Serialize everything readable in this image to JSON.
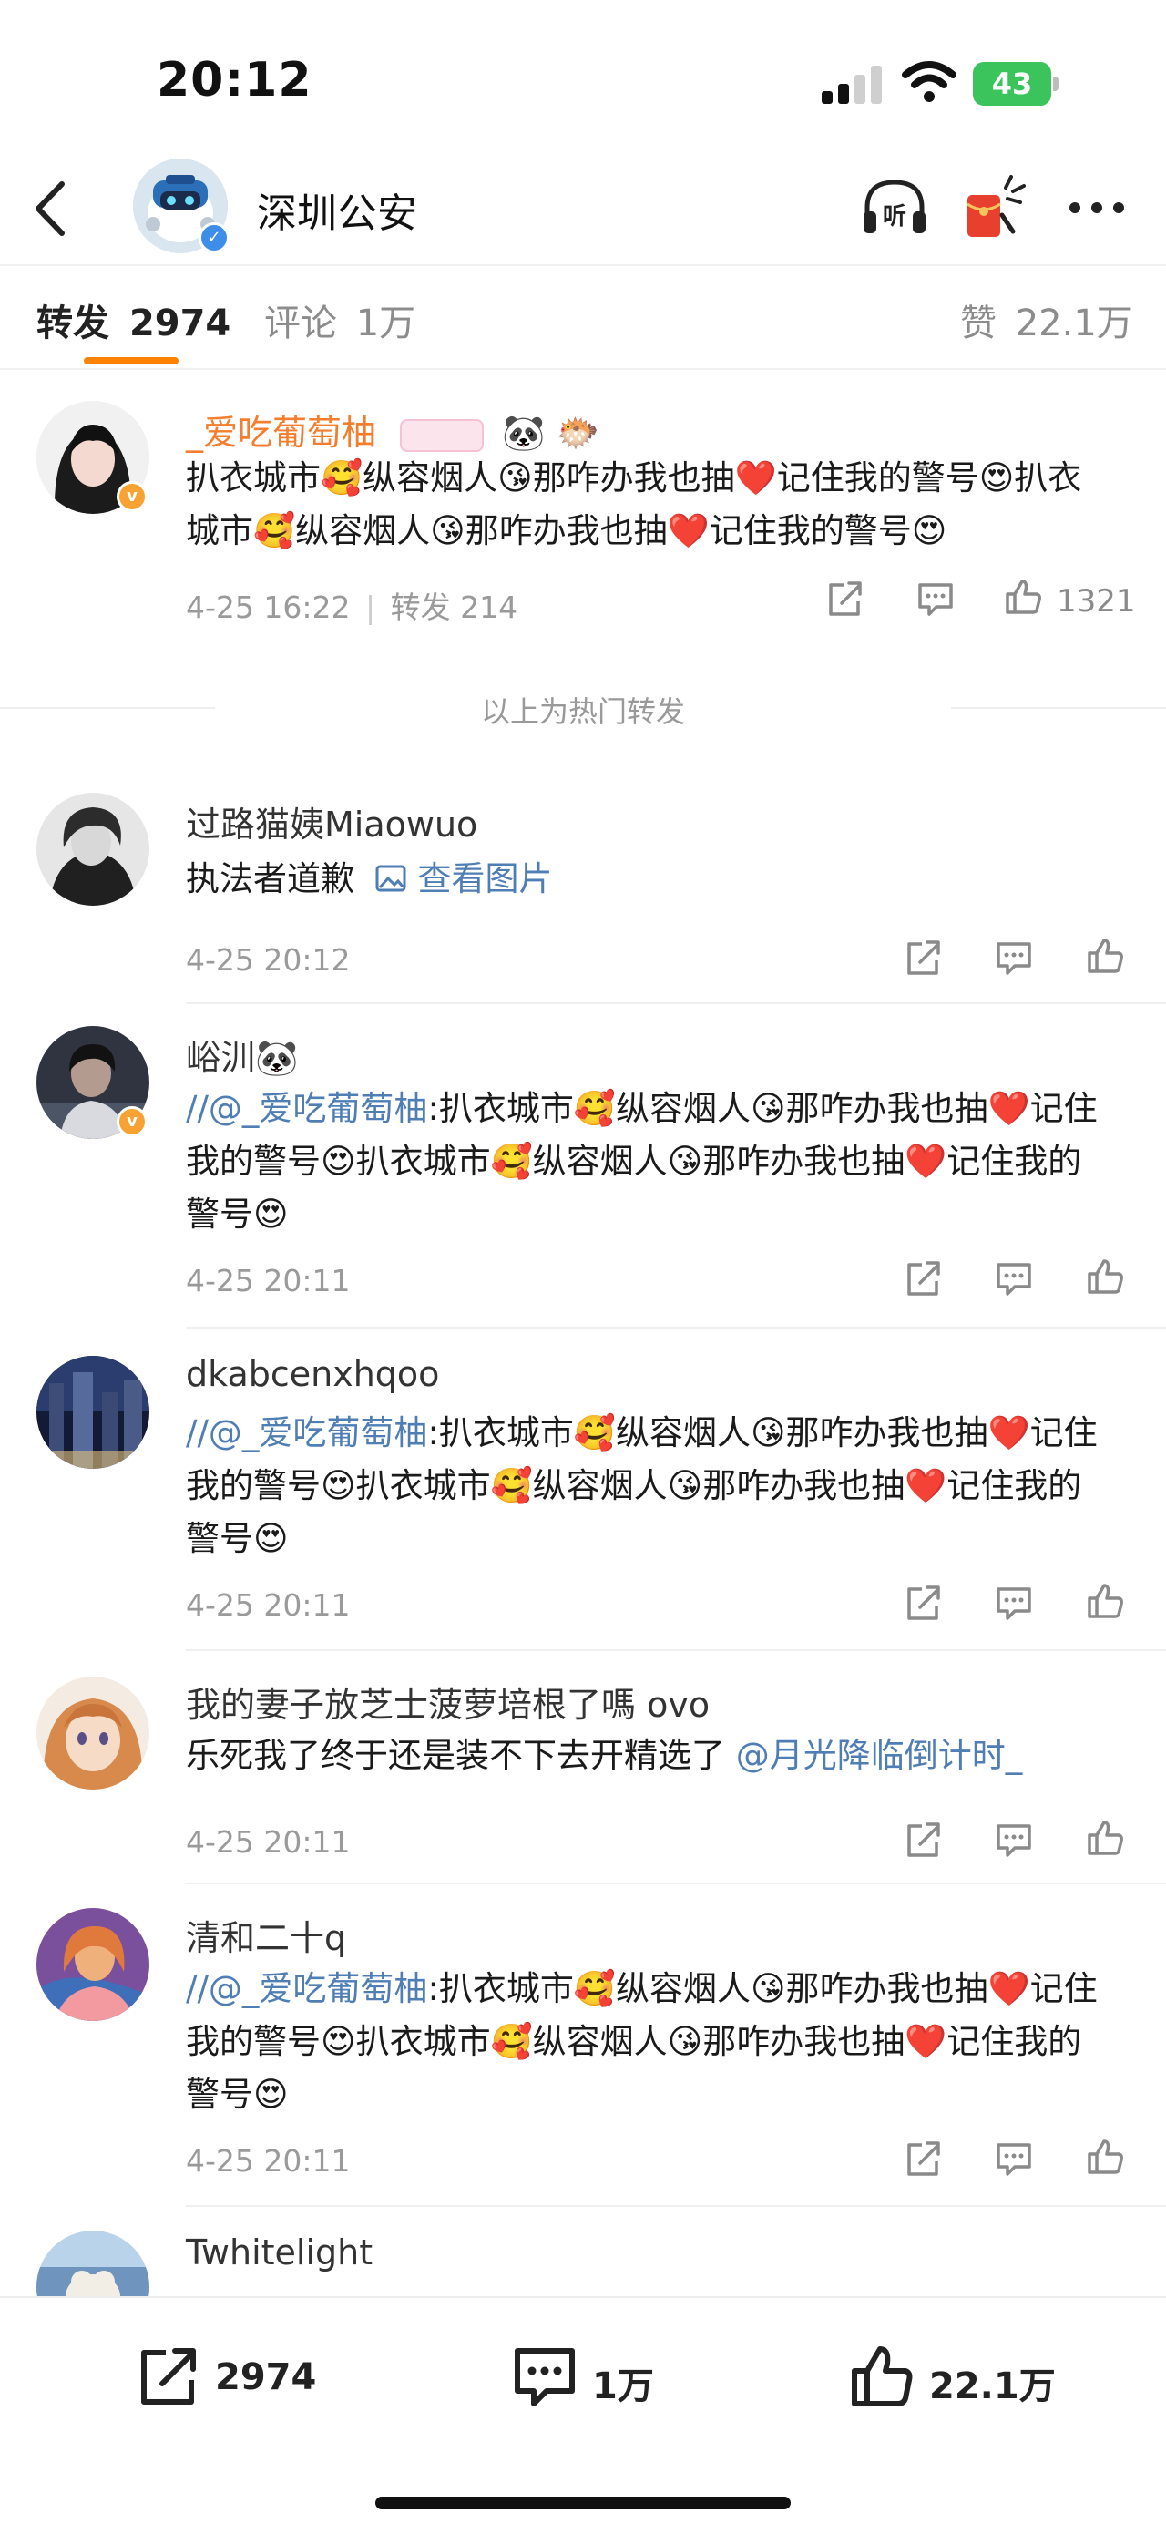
{
  "status": {
    "time": "20:12",
    "battery": "43"
  },
  "header": {
    "title": "深圳公安",
    "back_icon": "chevron-left-icon",
    "listen_icon": "headphones-listen-icon",
    "listen_label": "听",
    "redpacket_icon": "red-packet-icon",
    "more_icon": "more-dots-icon"
  },
  "tabs": {
    "repost_label": "转发",
    "repost_count": "2974",
    "comment_label": "评论",
    "comment_count": "1万",
    "like_label": "赞",
    "like_count": "22.1万"
  },
  "hot_item": {
    "name": "_爱吃葡萄柚",
    "text": "扒衣城市🥰纵容烟人😘那咋办我也抽❤️记住我的警号😍扒衣城市🥰纵容烟人😘那咋办我也抽❤️记住我的警号😍",
    "time": "4-25 16:22",
    "sep": "|",
    "repost": "转发 214",
    "likes": "1321"
  },
  "hot_divider_label": "以上为热门转发",
  "reposts": [
    {
      "name": "过路猫姨Miaowuo",
      "text": "执法者道歉",
      "link": "查看图片",
      "time": "4-25 20:12"
    },
    {
      "name": "峪汌🐼",
      "at": "//@_爱吃葡萄柚",
      "text": ":扒衣城市🥰纵容烟人😘那咋办我也抽❤️记住我的警号😍扒衣城市🥰纵容烟人😘那咋办我也抽❤️记住我的警号😍",
      "time": "4-25 20:11"
    },
    {
      "name": "dkabcenxhqoo",
      "at": "//@_爱吃葡萄柚",
      "text": ":扒衣城市🥰纵容烟人😘那咋办我也抽❤️记住我的警号😍扒衣城市🥰纵容烟人😘那咋办我也抽❤️记住我的警号😍",
      "time": "4-25 20:11"
    },
    {
      "name": "我的妻子放芝士菠萝培根了嗎 ovo",
      "text": "乐死我了终于还是装不下去开精选了 ",
      "at_tail": "@月光降临倒计时_",
      "time": "4-25 20:11"
    },
    {
      "name": "清和二十q",
      "at": "//@_爱吃葡萄柚",
      "text": ":扒衣城市🥰纵容烟人😘那咋办我也抽❤️记住我的警号😍扒衣城市🥰纵容烟人😘那咋办我也抽❤️记住我的警号😍",
      "time": "4-25 20:11"
    },
    {
      "name": "Twhitelight"
    }
  ],
  "bottom": {
    "repost": "2974",
    "comment": "1万",
    "like": "22.1万"
  },
  "colors": {
    "accent": "#ff8200",
    "link": "#4f7eb5",
    "name_orange": "#f47e2d"
  }
}
